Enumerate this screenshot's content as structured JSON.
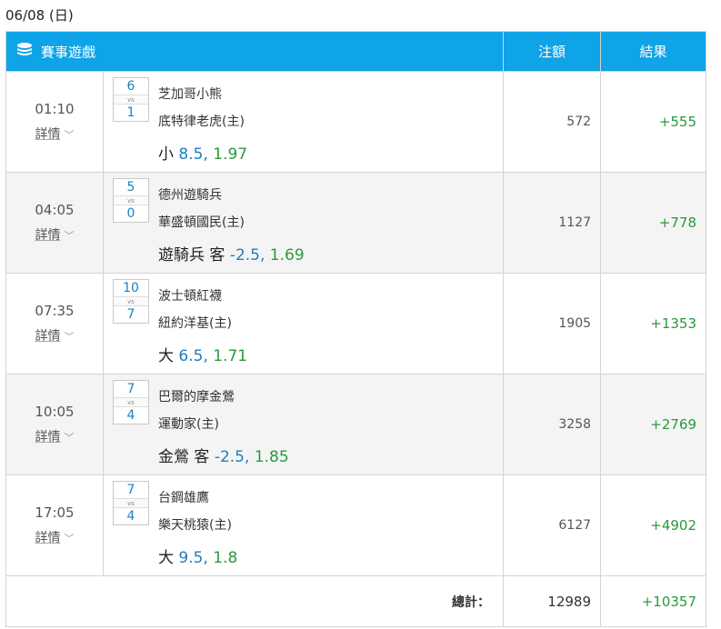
{
  "date_header": "06/08 (日)",
  "table_header": {
    "game": "賽事遊戲",
    "stake": "注額",
    "result": "結果",
    "game_icon": "coin-stack-icon"
  },
  "matches": [
    {
      "time": "01:10",
      "details_label": "詳情",
      "score_home": "6",
      "score_away": "1",
      "vs": "vs",
      "team1": "芝加哥小熊",
      "team2": "底特律老虎(主)",
      "bet_pick": "小",
      "bet_line": "8.5,",
      "bet_odds": "1.97",
      "stake": "572",
      "result": "+555"
    },
    {
      "time": "04:05",
      "details_label": "詳情",
      "score_home": "5",
      "score_away": "0",
      "vs": "vs",
      "team1": "德州遊騎兵",
      "team2": "華盛頓國民(主)",
      "bet_pick": "遊騎兵 客",
      "bet_line": "-2.5,",
      "bet_odds": "1.69",
      "stake": "1127",
      "result": "+778"
    },
    {
      "time": "07:35",
      "details_label": "詳情",
      "score_home": "10",
      "score_away": "7",
      "vs": "vs",
      "team1": "波士頓紅襪",
      "team2": "紐約洋基(主)",
      "bet_pick": "大",
      "bet_line": "6.5,",
      "bet_odds": "1.71",
      "stake": "1905",
      "result": "+1353"
    },
    {
      "time": "10:05",
      "details_label": "詳情",
      "score_home": "7",
      "score_away": "4",
      "vs": "vs",
      "team1": "巴爾的摩金鶯",
      "team2": "運動家(主)",
      "bet_pick": "金鶯 客",
      "bet_line": "-2.5,",
      "bet_odds": "1.85",
      "stake": "3258",
      "result": "+2769"
    },
    {
      "time": "17:05",
      "details_label": "詳情",
      "score_home": "7",
      "score_away": "4",
      "vs": "vs",
      "team1": "台鋼雄鷹",
      "team2": "樂天桃猿(主)",
      "bet_pick": "大",
      "bet_line": "9.5,",
      "bet_odds": "1.8",
      "stake": "6127",
      "result": "+4902"
    }
  ],
  "total": {
    "label": "總計：",
    "stake": "12989",
    "result": "+10357"
  },
  "colors": {
    "header_bg": "#0fa3e8",
    "positive": "#2a9a3a",
    "line": "#1e7fc2"
  }
}
